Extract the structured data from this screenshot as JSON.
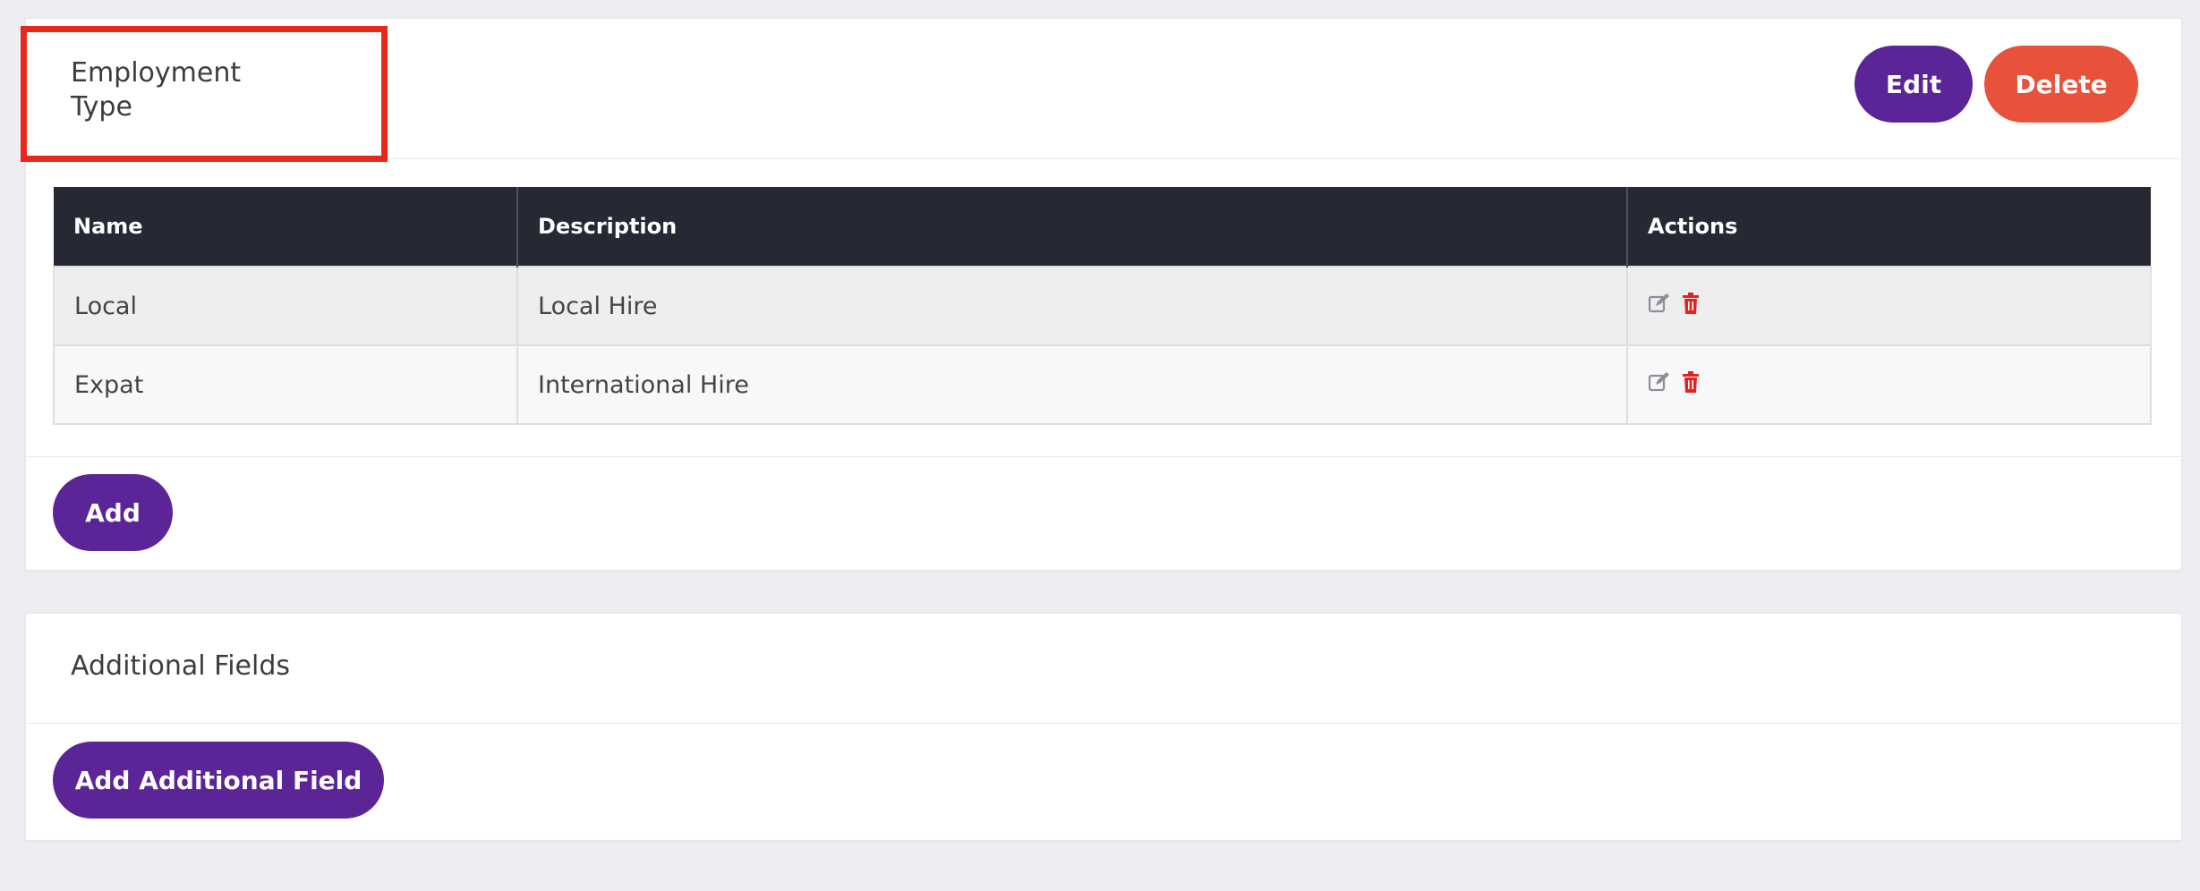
{
  "employment_section": {
    "title": "Employment Type",
    "edit_label": "Edit",
    "delete_label": "Delete",
    "add_label": "Add",
    "table": {
      "headers": [
        "Name",
        "Description",
        "Actions"
      ],
      "rows": [
        {
          "name": "Local",
          "description": "Local Hire",
          "actions": [
            "edit-icon",
            "trash-icon"
          ]
        },
        {
          "name": "Expat",
          "description": "International Hire",
          "actions": [
            "edit-icon",
            "trash-icon"
          ]
        }
      ]
    }
  },
  "additional_section": {
    "title": "Additional Fields",
    "add_field_label": "Add Additional Field"
  },
  "colors": {
    "primary": "#5b2497",
    "danger": "#e8513a",
    "table_header_bg": "#262834",
    "highlight": "#e8281a",
    "edit_icon": "#8a8f99",
    "trash_icon": "#e02424"
  }
}
